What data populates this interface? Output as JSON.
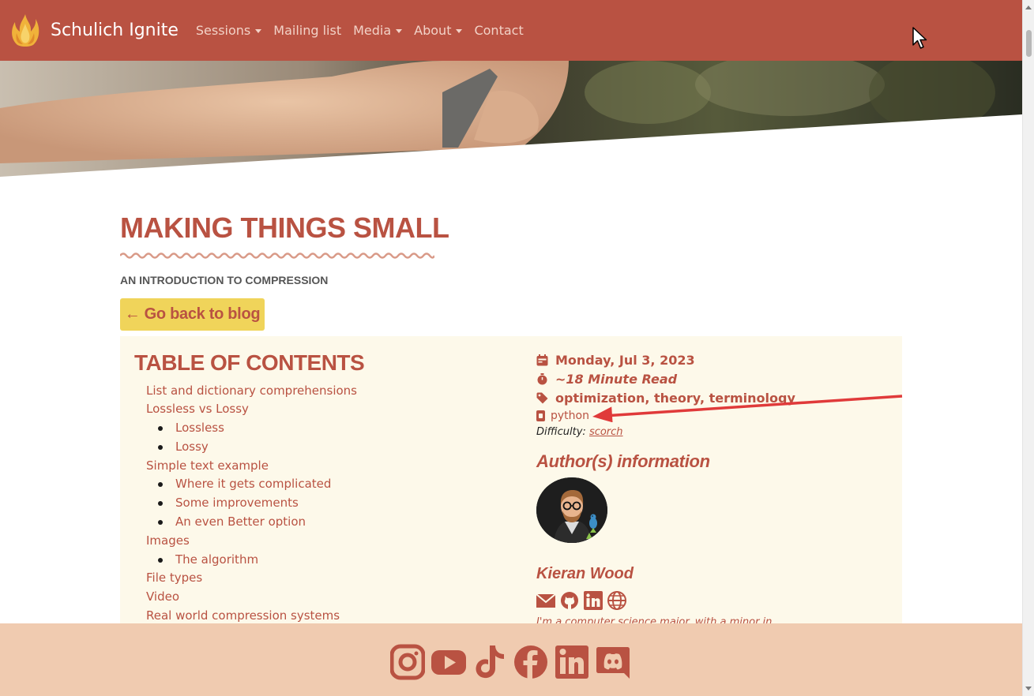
{
  "navbar": {
    "brand": "Schulich Ignite",
    "items": [
      {
        "label": "Sessions",
        "dropdown": true
      },
      {
        "label": "Mailing list",
        "dropdown": false
      },
      {
        "label": "Media",
        "dropdown": true
      },
      {
        "label": "About",
        "dropdown": true
      },
      {
        "label": "Contact",
        "dropdown": false
      }
    ]
  },
  "post": {
    "title": "MAKING THINGS SMALL",
    "subtitle": "AN INTRODUCTION TO COMPRESSION",
    "back_label": "← Go back to blog"
  },
  "toc": {
    "title": "TABLE OF CONTENTS",
    "items": [
      "List and dictionary comprehensions",
      "Lossless vs Lossy",
      "Lossless",
      "Lossy",
      "Simple text example",
      "Where it gets complicated",
      "Some improvements",
      "An even Better option",
      "Images",
      "The algorithm",
      "File types",
      "Video",
      "Real world compression systems"
    ]
  },
  "meta": {
    "date": "Monday, Jul 3, 2023",
    "read_time": "~18 Minute Read",
    "tags": "optimization, theory, terminology",
    "language": "python",
    "difficulty_label": "Difficulty:",
    "difficulty_value": "scorch"
  },
  "author": {
    "heading": "Author(s) information",
    "name": "Kieran Wood",
    "bio": "I'm a computer science major, with a minor in",
    "socials": [
      "email-icon",
      "github-icon",
      "linkedin-icon",
      "globe-icon"
    ]
  },
  "footer": {
    "socials": [
      "instagram-icon",
      "youtube-icon",
      "tiktok-icon",
      "facebook-icon",
      "linkedin-icon",
      "discord-icon"
    ]
  },
  "colors": {
    "brand": "#b95242",
    "button": "#f0d45a",
    "panel": "#fdf9ea",
    "footer": "#f0cbb0"
  }
}
